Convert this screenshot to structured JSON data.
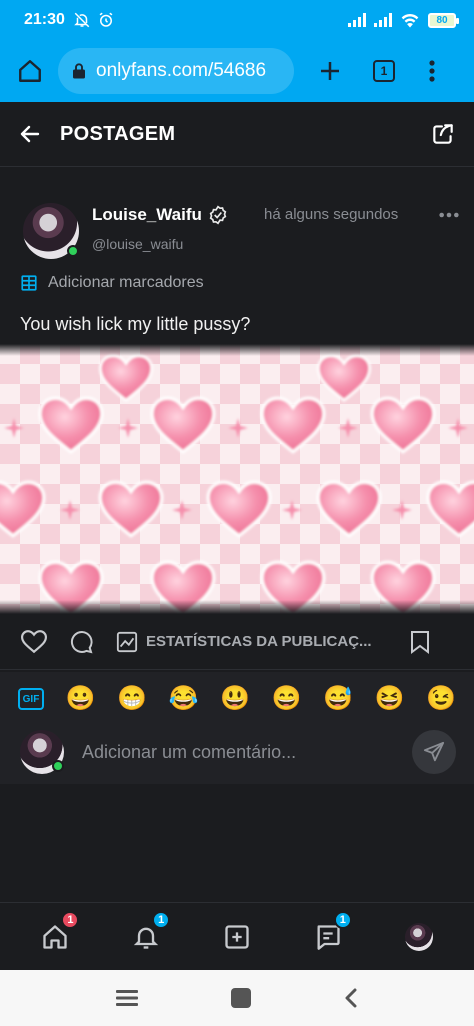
{
  "status_bar": {
    "time": "21:30",
    "battery": "80"
  },
  "browser": {
    "url": "onlyfans.com/54686",
    "tab_count": "1"
  },
  "header": {
    "title": "POSTAGEM"
  },
  "post": {
    "author_name": "Louise_Waifu",
    "author_handle": "@louise_waifu",
    "timestamp": "há alguns segundos",
    "markers_label": "Adicionar marcadores",
    "text": "You wish lick my little pussy?",
    "stats_label": "ESTATÍSTICAS DA PUBLICAÇ..."
  },
  "emojis": [
    "😀",
    "😁",
    "😂",
    "😃",
    "😄",
    "😅",
    "😆",
    "😉"
  ],
  "gif_label": "GIF",
  "comment": {
    "placeholder": "Adicionar um comentário..."
  },
  "bottom_nav": {
    "home_badge": "1",
    "notifications_badge": "1",
    "messages_badge": "1"
  },
  "colors": {
    "accent": "#00aff0",
    "browser_bar": "#00a8f2",
    "background": "#1b1c1f",
    "badge_red": "#e84a5f",
    "online": "#2fd05a"
  }
}
